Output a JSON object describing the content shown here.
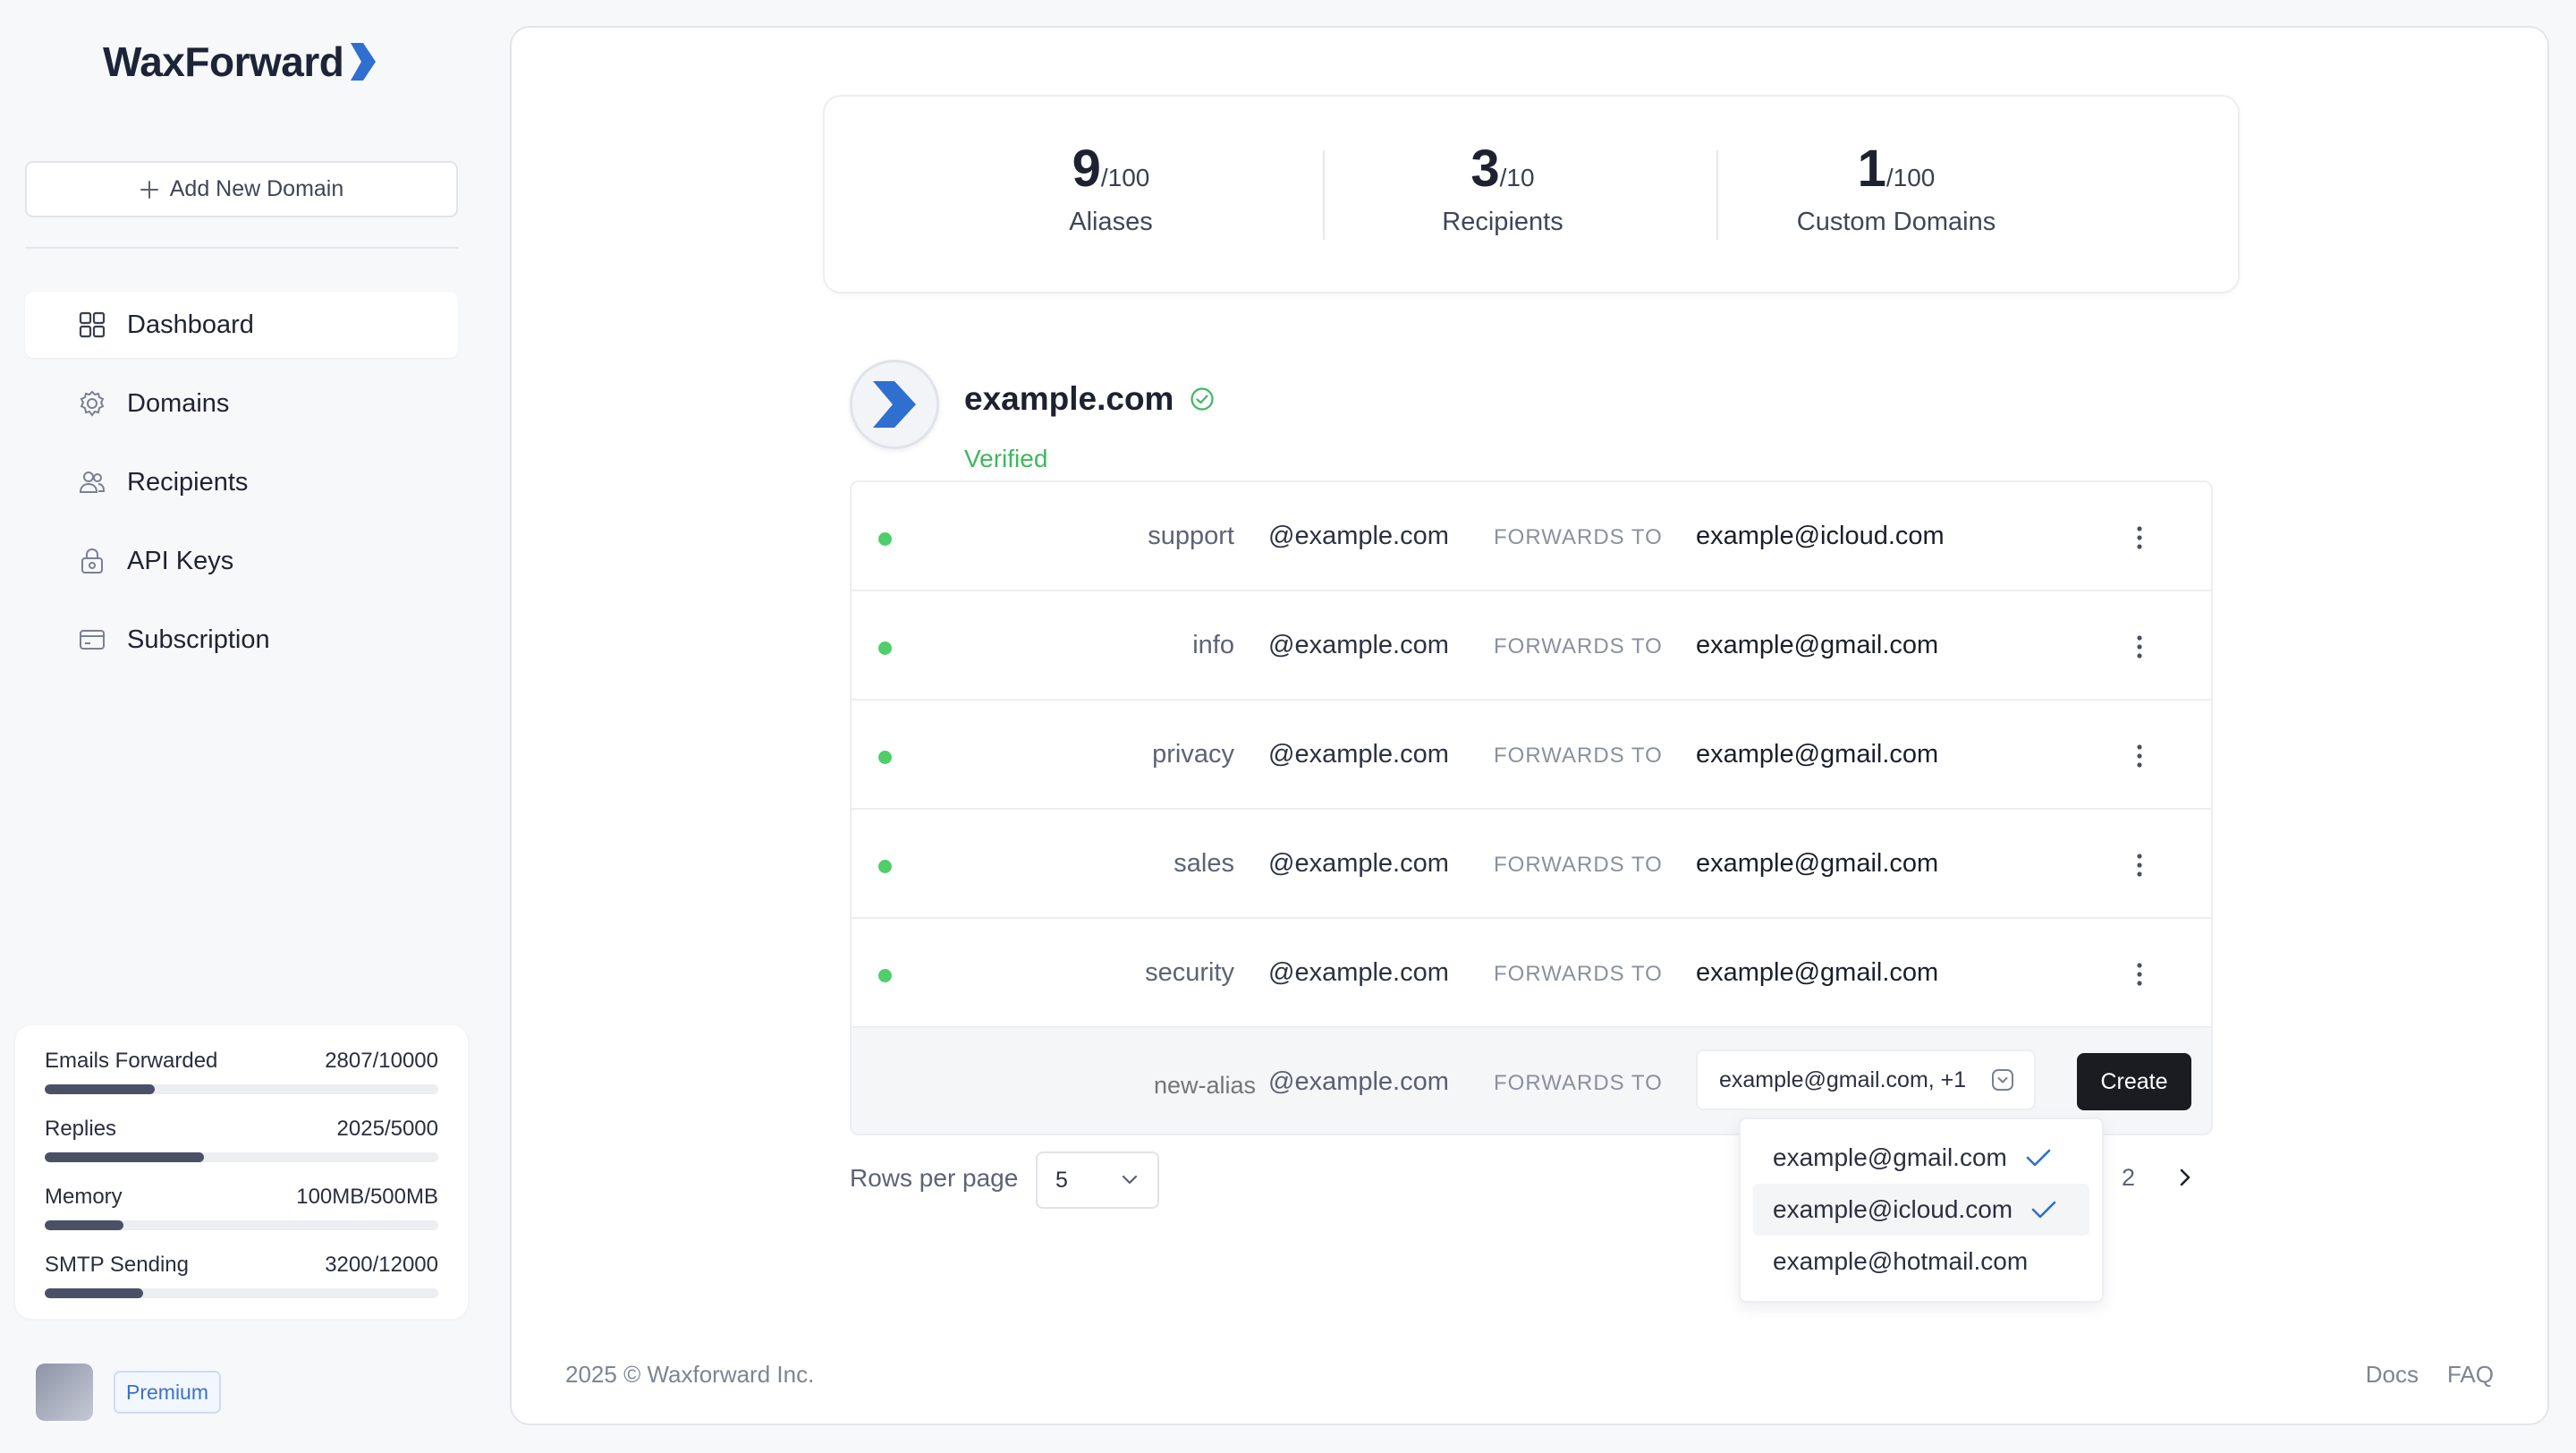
{
  "app": {
    "name": "WaxForward",
    "brand_color": "#2f6fd0"
  },
  "sidebar": {
    "add_domain_label": "Add New Domain",
    "nav": [
      {
        "label": "Dashboard",
        "icon": "grid-icon",
        "active": true
      },
      {
        "label": "Domains",
        "icon": "gear-icon",
        "active": false
      },
      {
        "label": "Recipients",
        "icon": "users-icon",
        "active": false
      },
      {
        "label": "API Keys",
        "icon": "lock-icon",
        "active": false
      },
      {
        "label": "Subscription",
        "icon": "card-icon",
        "active": false
      }
    ],
    "usage": [
      {
        "label": "Emails Forwarded",
        "value": "2807/10000",
        "fraction": 0.28
      },
      {
        "label": "Replies",
        "value": "2025/5000",
        "fraction": 0.405
      },
      {
        "label": "Memory",
        "value": "100MB/500MB",
        "fraction": 0.2
      },
      {
        "label": "SMTP Sending",
        "value": "3200/12000",
        "fraction": 0.25
      }
    ],
    "plan_badge": "Premium"
  },
  "stats": [
    {
      "value": "9",
      "limit": "/100",
      "label": "Aliases"
    },
    {
      "value": "3",
      "limit": "/10",
      "label": "Recipients"
    },
    {
      "value": "1",
      "limit": "/100",
      "label": "Custom Domains"
    }
  ],
  "domain": {
    "name": "example.com",
    "status": "Verified",
    "status_color": "#3fb85e"
  },
  "aliases": [
    {
      "alias": "support",
      "domain": "@example.com",
      "forwards_label": "FORWARDS TO",
      "destination": "example@icloud.com",
      "active": true
    },
    {
      "alias": "info",
      "domain": "@example.com",
      "forwards_label": "FORWARDS TO",
      "destination": "example@gmail.com",
      "active": true
    },
    {
      "alias": "privacy",
      "domain": "@example.com",
      "forwards_label": "FORWARDS TO",
      "destination": "example@gmail.com",
      "active": true
    },
    {
      "alias": "sales",
      "domain": "@example.com",
      "forwards_label": "FORWARDS TO",
      "destination": "example@gmail.com",
      "active": true
    },
    {
      "alias": "security",
      "domain": "@example.com",
      "forwards_label": "FORWARDS TO",
      "destination": "example@gmail.com",
      "active": true
    }
  ],
  "new_alias": {
    "placeholder": "new-alias",
    "domain": "@example.com",
    "forwards_label": "FORWARDS TO",
    "selected_recipients": "example@gmail.com, +1",
    "create_label": "Create"
  },
  "recipient_options": [
    {
      "email": "example@gmail.com",
      "checked": true
    },
    {
      "email": "example@icloud.com",
      "checked": true
    },
    {
      "email": "example@hotmail.com",
      "checked": false
    }
  ],
  "pagination": {
    "rows_label": "Rows per page",
    "rows_value": "5",
    "page": "2"
  },
  "footer": {
    "copyright": "2025 ©  Waxforward Inc.",
    "links": [
      "Docs",
      "FAQ"
    ]
  }
}
